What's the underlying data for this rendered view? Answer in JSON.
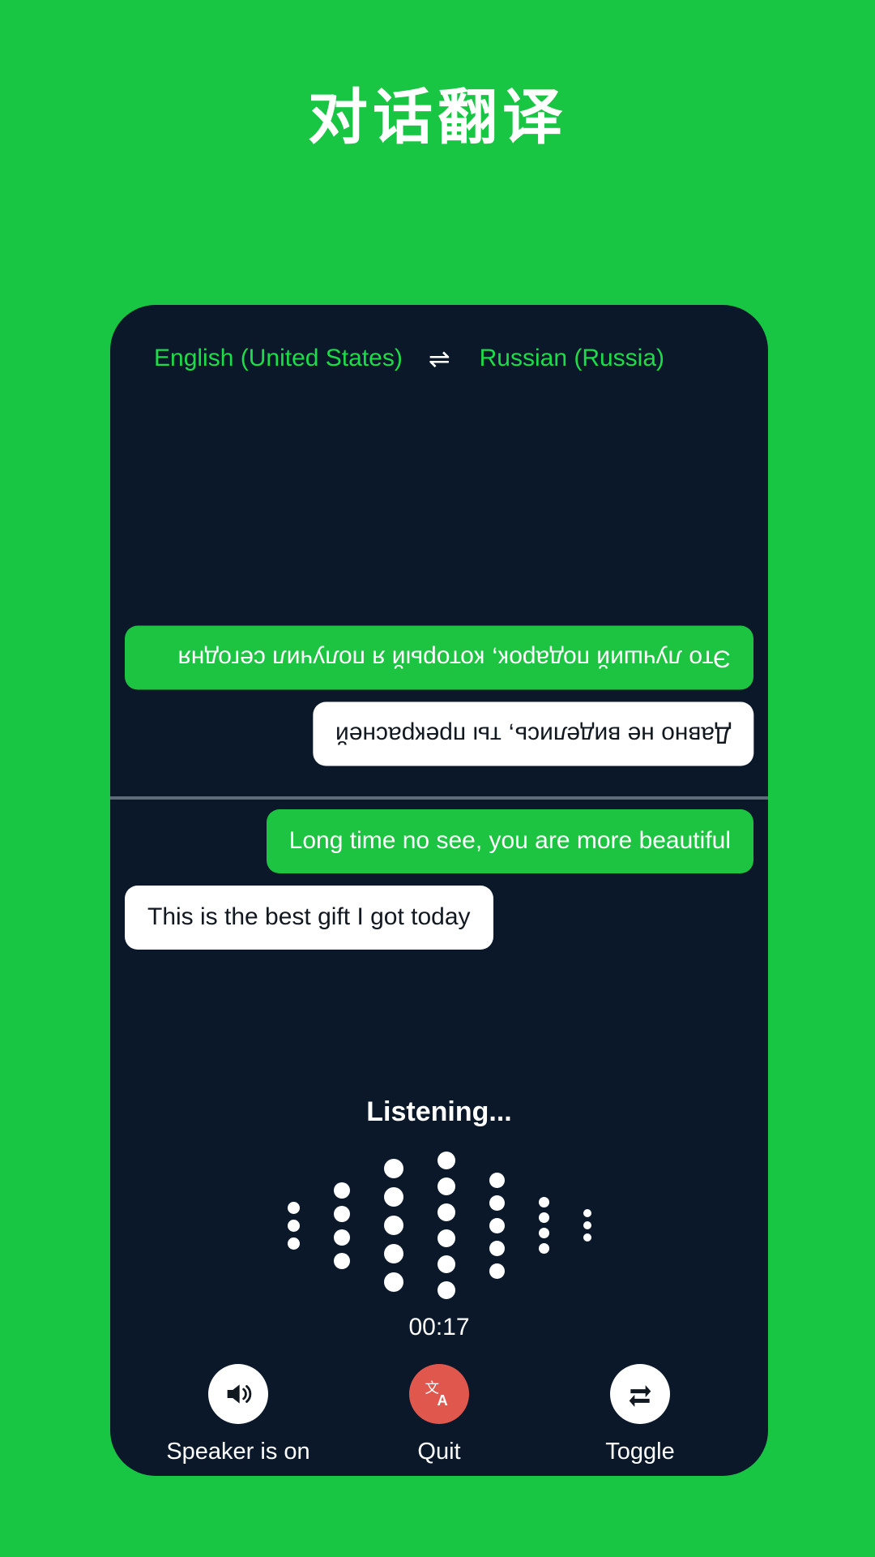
{
  "page": {
    "title": "对话翻译",
    "background_color": "#18c644"
  },
  "card": {
    "background_color": "#0a1829",
    "accent_green": "#1dc442",
    "lang_text_color": "#1ddc4a",
    "danger_color": "#e0574e"
  },
  "language_bar": {
    "source_language": "English (United States)",
    "swap_icon": "swap-horizontal-icon",
    "swap_glyph": "⇌",
    "target_language": "Russian (Russia)"
  },
  "translated_panel": {
    "messages": [
      {
        "id": "ru-0",
        "text": "Это лучший подарок, который я получил сегодня",
        "style": "green",
        "align": "left",
        "rotated": true
      },
      {
        "id": "ru-1",
        "text": "Давно не виделись, ты прекрасней",
        "style": "white",
        "align": "right",
        "rotated": true
      }
    ]
  },
  "source_panel": {
    "messages": [
      {
        "id": "en-0",
        "text": "Long time no see, you are more beautiful",
        "style": "green",
        "align": "right",
        "rotated": false
      },
      {
        "id": "en-1",
        "text": "This is the best gift I got today",
        "style": "white",
        "align": "left",
        "rotated": false
      }
    ]
  },
  "listening": {
    "status_label": "Listening...",
    "timer": "00:17",
    "waveform": {
      "columns": [
        {
          "count": 3,
          "size": 15
        },
        {
          "count": 4,
          "size": 20
        },
        {
          "count": 5,
          "size": 24
        },
        {
          "count": 6,
          "size": 22
        },
        {
          "count": 5,
          "size": 19
        },
        {
          "count": 4,
          "size": 13
        },
        {
          "count": 3,
          "size": 10
        }
      ]
    }
  },
  "controls": [
    {
      "id": "speaker",
      "label": "Speaker is on",
      "icon": "speaker-on-icon",
      "circle_style": "light"
    },
    {
      "id": "quit",
      "label": "Quit",
      "icon": "translate-icon",
      "circle_style": "danger"
    },
    {
      "id": "toggle",
      "label": "Toggle",
      "icon": "swap-repeat-icon",
      "circle_style": "light"
    }
  ]
}
